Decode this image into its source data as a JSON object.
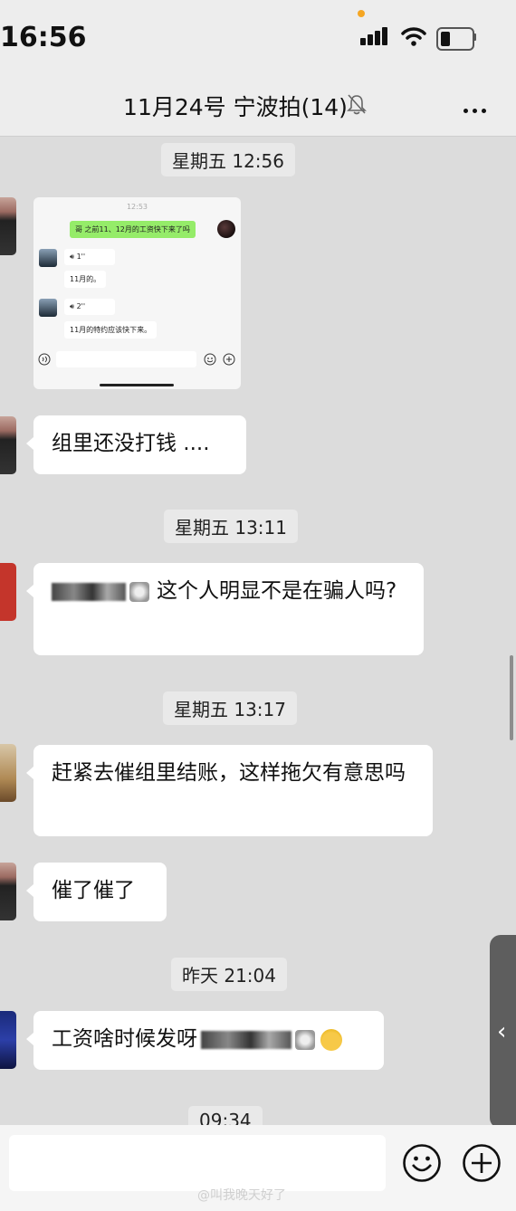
{
  "status_bar": {
    "time": "16:56",
    "icons": [
      "signal-icon",
      "wifi-icon",
      "battery-icon"
    ]
  },
  "header": {
    "title": "11月24号 宁波拍(14)",
    "icons": [
      "mute-icon",
      "more-icon"
    ]
  },
  "messages": {
    "stamp1": "星期五 12:56",
    "screenshot": {
      "time": "12:53",
      "sent": "哥 之前11、12月的工资快下来了吗",
      "voice1": "1''",
      "reply1": "11月的。",
      "voice2": "2''",
      "reply2": "11月的特约应该快下来。"
    },
    "bubble1": "组里还没打钱 ....",
    "stamp2": "星期五 13:11",
    "bubble2": "这个人明显不是在骗人吗?",
    "stamp3": "星期五 13:17",
    "bubble3": "赶紧去催组里结账，这样拖欠有意思吗",
    "bubble4": "催了催了",
    "stamp4": "昨天 21:04",
    "bubble5": "工资啥时候发呀",
    "stamp5": "09:34"
  },
  "input_bar": {
    "placeholder": "",
    "icons": [
      "emoji-icon",
      "plus-icon"
    ]
  },
  "watermark": "@叫我晚天好了",
  "colors": {
    "background": "#dcdcdc",
    "bubble": "#ffffff",
    "sent_bubble": "#95ec69",
    "accent_orange": "#f5a623"
  }
}
